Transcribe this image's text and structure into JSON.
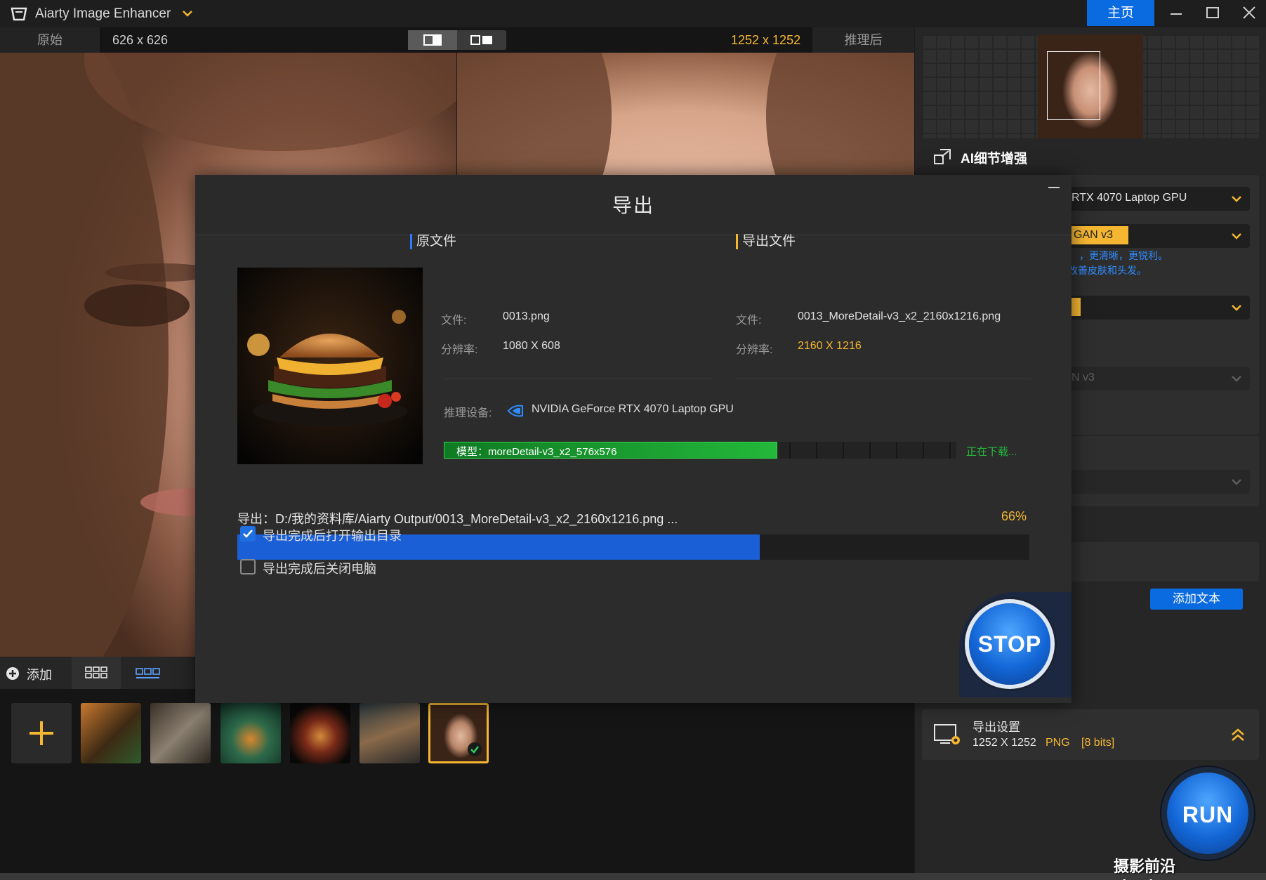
{
  "titlebar": {
    "app_title": "Aiarty Image Enhancer",
    "home_label": "主页",
    "icons": [
      "app-logo-icon",
      "chevron-down-icon",
      "minimize-icon",
      "maximize-icon",
      "close-icon"
    ]
  },
  "compare": {
    "left_label": "原始",
    "left_resolution": "626 x 626",
    "right_resolution": "1252 x 1252",
    "right_label": "推理后"
  },
  "side": {
    "section_title": "AI细节增强",
    "gpu_select": "RTX 4070 Laptop GPU",
    "model_tag": "GAN  v3",
    "hint_line1": "，更清晰，更锐利。",
    "hint_line2": "改善皮肤和头发。",
    "disabled_select": "N  v3",
    "add_text_label": "添加文本"
  },
  "export_settings": {
    "title": "导出设置",
    "resolution": "1252 X 1252",
    "format": "PNG",
    "bits": "[8 bits]"
  },
  "run": {
    "label": "RUN"
  },
  "bottom": {
    "add_label": "添加",
    "thumbnails": [
      "tiger",
      "butterfly",
      "jar-plant",
      "burger",
      "dog-goggles",
      "portrait"
    ]
  },
  "modal": {
    "title": "导出",
    "original": {
      "heading": "原文件",
      "file_key": "文件:",
      "file_val": "0013.png",
      "res_key": "分辨率:",
      "res_val": "1080 X 608"
    },
    "output": {
      "heading": "导出文件",
      "file_key": "文件:",
      "file_val": "0013_MoreDetail-v3_x2_2160x1216.png",
      "res_key": "分辨率:",
      "res_val": "2160 X 1216"
    },
    "device_key": "推理设备:",
    "device_val": "NVIDIA GeForce RTX 4070 Laptop GPU",
    "model_bar_label": "模型：moreDetail-v3_x2_576x576",
    "model_progress": 0.65,
    "model_status": "正在下载...",
    "export_path": "导出：D:/我的资料库/Aiarty Output/0013_MoreDetail-v3_x2_2160x1216.png ...",
    "export_percent": "66%",
    "export_progress": 0.66,
    "option_open_folder": "导出完成后打开输出目录",
    "option_open_folder_checked": true,
    "option_shutdown": "导出完成后关闭电脑",
    "option_shutdown_checked": false,
    "stop_label": "STOP"
  },
  "watermark": "摄影前沿 sheyingzyz.com",
  "colors": {
    "accent_yellow": "#f5b731",
    "accent_blue": "#0a6be0",
    "progress_green": "#23b83b"
  }
}
